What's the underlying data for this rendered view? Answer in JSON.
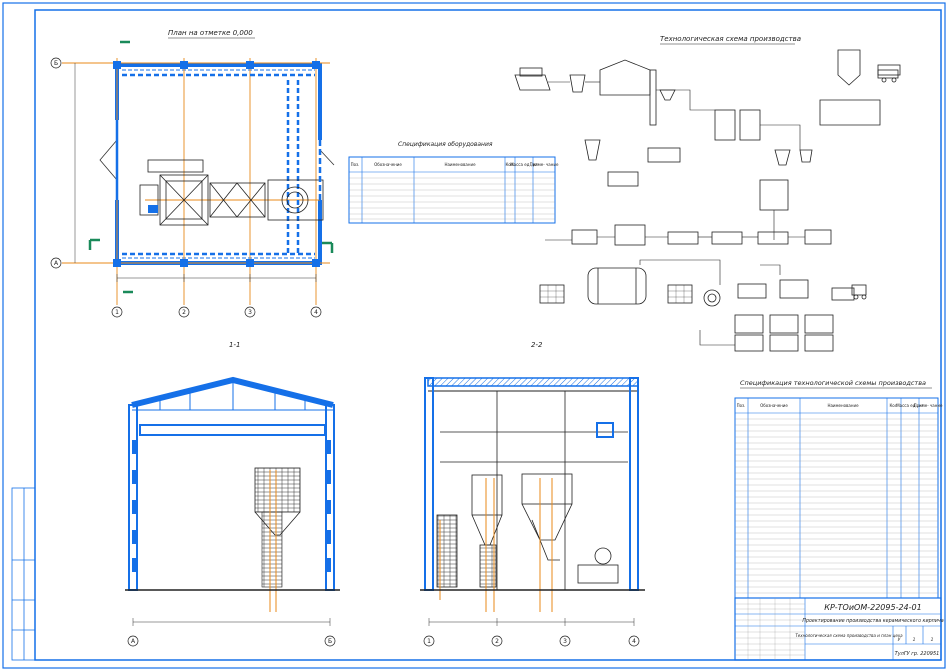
{
  "titles": {
    "plan": "План на отметке 0,000",
    "process_scheme": "Технологическая схема производства",
    "building_spec": "Спецификация оборудования",
    "process_spec": "Спецификация технологической схемы производства",
    "section_1": "1-1",
    "section_2": "2-2"
  },
  "grid_axes": {
    "columns": [
      "1",
      "2",
      "3",
      "4"
    ],
    "rows": [
      "Б",
      "А"
    ]
  },
  "building_spec_headers": [
    "Поз.",
    "Обозначение",
    "Наименование",
    "Кол.",
    "Масса ед., кг",
    "Приме- чание"
  ],
  "process_spec_headers": [
    "Поз.",
    "Обозначение",
    "Наименование",
    "Кол.",
    "Масса ед., кг",
    "Приме- чание"
  ],
  "title_block": {
    "doc_code": "КР-ТОиОМ-22095-24-01",
    "project_title": "Проектирование производства керамического кирпича",
    "sheet_title": "Технологическая схема производства и план цеха",
    "sheet_num": "1",
    "sheets_total": "1",
    "stage": "У",
    "org": "ТулГУ гр. 220951"
  },
  "colors": {
    "structure": "#1570e8",
    "axis": "#e88a1a",
    "ink": "#222222",
    "green_marker": "#1a8a5a"
  }
}
